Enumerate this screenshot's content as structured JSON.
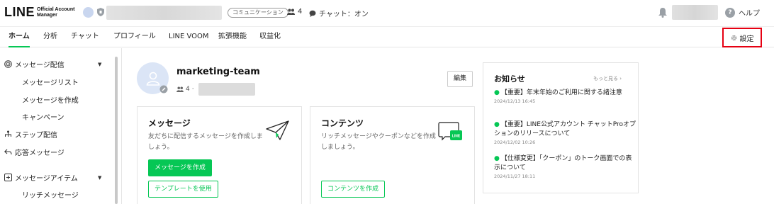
{
  "header": {
    "logo_main": "LINE",
    "logo_sub_1": "Official Account",
    "logo_sub_2": "Manager",
    "comm_badge": "コミュニケーション",
    "friend_count": "4",
    "chat_status": "チャット：オン",
    "help_label": "ヘルプ"
  },
  "tabs": [
    {
      "label": "ホーム"
    },
    {
      "label": "分析"
    },
    {
      "label": "チャット"
    },
    {
      "label": "プロフィール"
    },
    {
      "label": "LINE VOOM"
    },
    {
      "label": "拡張機能"
    },
    {
      "label": "収益化"
    }
  ],
  "settings_label": "設定",
  "sidebar": {
    "section1": "メッセージ配信",
    "section1_items": [
      "メッセージリスト",
      "メッセージを作成",
      "キャンペーン"
    ],
    "step": "ステップ配信",
    "auto_reply": "応答メッセージ",
    "section2": "メッセージアイテム",
    "section2_items": [
      "リッチメッセージ"
    ]
  },
  "profile": {
    "name": "marketing-team",
    "friends": "4",
    "separator": "·",
    "edit_label": "編集"
  },
  "cards": {
    "message": {
      "title": "メッセージ",
      "desc": "友だちに配信するメッセージを作成しましょう。",
      "primary": "メッセージを作成",
      "secondary": "テンプレートを使用"
    },
    "content": {
      "title": "コンテンツ",
      "desc": "リッチメッセージやクーポンなどを作成しましょう。",
      "button": "コンテンツを作成",
      "icon_text": "LINE"
    }
  },
  "news": {
    "title": "お知らせ",
    "more": "もっと見る",
    "items": [
      {
        "text": "【重要】年末年始のご利用に関する諸注意",
        "date": "2024/12/13 16:45"
      },
      {
        "text": "【重要】LINE公式アカウント チャットProオプションのリリースについて",
        "date": "2024/12/02 10:26"
      },
      {
        "text": "【仕様変更】「クーポン」のトーク画面での表示について",
        "date": "2024/11/27 18:11"
      }
    ]
  }
}
